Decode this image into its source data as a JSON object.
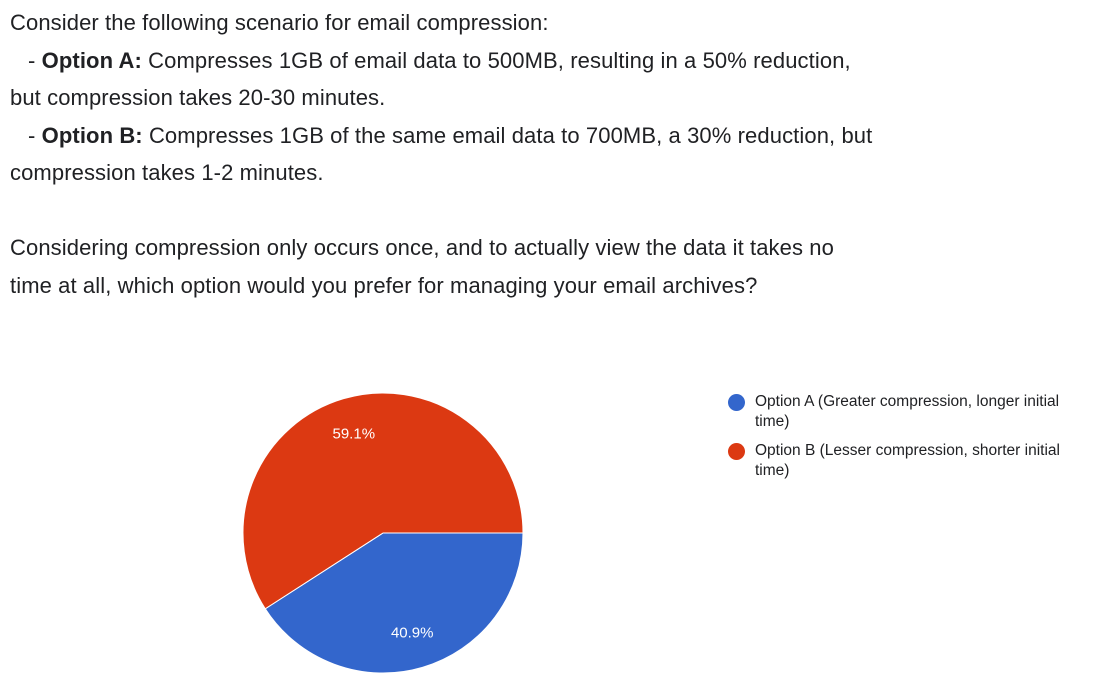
{
  "question": {
    "intro": "Consider the following scenario for email compression:",
    "option_a_prefix": "- ",
    "option_a_bold": "Option A:",
    "option_a_line1_rest": " Compresses 1GB of email data to 500MB, resulting in a 50% reduction,",
    "option_a_line2": "but compression takes 20-30 minutes.",
    "option_b_prefix": "- ",
    "option_b_bold": "Option B:",
    "option_b_line1_rest": " Compresses 1GB of the same email data to 700MB, a 30% reduction, but",
    "option_b_line2": "compression takes 1-2 minutes.",
    "prompt_line1": "Considering compression only occurs once, and to actually view the data it takes no",
    "prompt_line2": "time at all, which option would you prefer for managing your email archives?"
  },
  "chart_data": {
    "type": "pie",
    "title": "",
    "slices": [
      {
        "name": "Option A (Greater compression, longer initial time)",
        "value": 40.9,
        "label": "40.9%",
        "color": "#3366cc"
      },
      {
        "name": "Option B (Lesser compression, shorter initial time)",
        "value": 59.1,
        "label": "59.1%",
        "color": "#dc3912"
      }
    ],
    "legend_position": "right"
  }
}
